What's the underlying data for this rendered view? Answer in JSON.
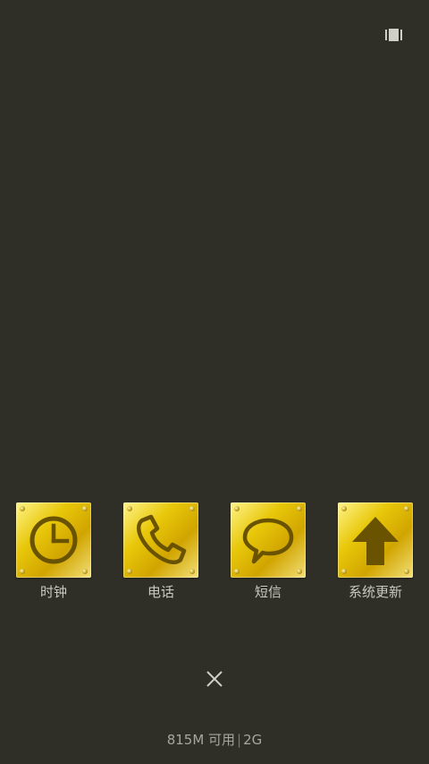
{
  "apps": [
    {
      "label": "时钟",
      "icon": "clock-icon"
    },
    {
      "label": "电话",
      "icon": "phone-icon"
    },
    {
      "label": "短信",
      "icon": "message-bubble-icon"
    },
    {
      "label": "系统更新",
      "icon": "arrow-up-icon"
    }
  ],
  "memory": {
    "available": "815M 可用",
    "total": "2G",
    "separator": "|"
  },
  "colors": {
    "background": "#2f2f28",
    "tile_gold": "#e8c70a",
    "glyph_dark": "#6a5300",
    "label_text": "#c9c9c0"
  }
}
